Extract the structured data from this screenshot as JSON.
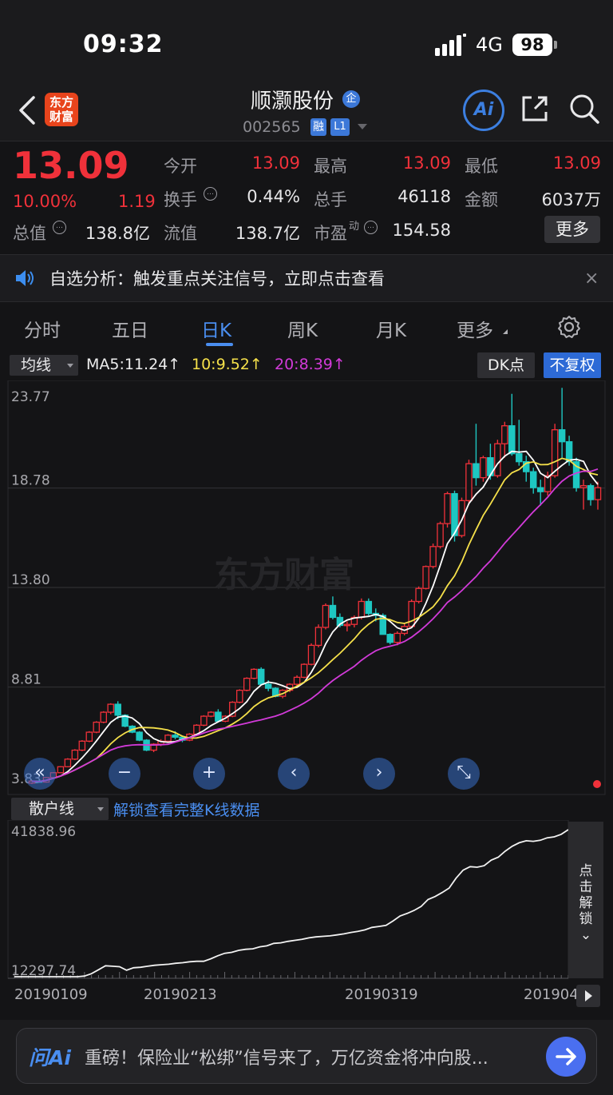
{
  "status_bar": {
    "time": "09:32",
    "network": "4G",
    "battery": "98"
  },
  "header": {
    "app_logo_line1": "东方",
    "app_logo_line2": "财富",
    "stock_name": "顺灏股份",
    "enterprise_badge": "企",
    "stock_code": "002565",
    "margin_badge": "融",
    "level_badge": "L1",
    "ai_label": "Ai"
  },
  "quote": {
    "price": "13.09",
    "change_pct": "10.00%",
    "change_amt": "1.19",
    "open_label": "今开",
    "open": "13.09",
    "high_label": "最高",
    "high": "13.09",
    "low_label": "最低",
    "low": "13.09",
    "turnover_label": "换手",
    "turnover": "0.44%",
    "volume_label": "总手",
    "volume": "46118",
    "amount_label": "金额",
    "amount": "6037万",
    "total_cap_label": "总值",
    "total_cap": "138.8亿",
    "float_cap_label": "流值",
    "float_cap": "138.7亿",
    "pe_label": "市盈",
    "pe_sup": "动",
    "pe": "154.58",
    "more_label": "更多",
    "info_glyph": "…"
  },
  "alert": {
    "text": "自选分析：触发重点关注信号，立即点击查看",
    "close": "×"
  },
  "tabs": [
    {
      "label": "分时"
    },
    {
      "label": "五日"
    },
    {
      "label": "日K"
    },
    {
      "label": "周K"
    },
    {
      "label": "月K"
    },
    {
      "label": "更多"
    }
  ],
  "ma_row": {
    "selector": "均线",
    "ma5": "MA5:11.24↑",
    "ma10": "10:9.52↑",
    "ma20": "20:8.39↑",
    "dk_label": "DK点",
    "fq_label": "不复权"
  },
  "watermark": "东方财富",
  "controls": {
    "fast_back": "«",
    "zoom_out": "−",
    "zoom_in": "+",
    "prev": "‹",
    "next": "›",
    "fullscreen": "⤡"
  },
  "lower": {
    "selector": "散户线",
    "unlock_link": "解锁查看完整K线数据",
    "unlock_side_lines": [
      "点",
      "击",
      "解",
      "锁"
    ],
    "unlock_side_arrow": "⌄"
  },
  "bottom": {
    "ask_ai": "问Ai",
    "prompt": "重磅！保险业“松绑”信号来了，万亿资金将冲向股..."
  },
  "colors": {
    "up": "#f0313a",
    "down": "#1ec7c2",
    "ma5": "#ffffff",
    "ma10": "#f5e04a",
    "ma20": "#d23ad9",
    "accent": "#4a8ef0"
  },
  "chart_data": [
    {
      "type": "candlestick",
      "title": "",
      "y_ticks": [
        "23.77",
        "18.78",
        "13.80",
        "8.81",
        "3.83"
      ],
      "ylim": [
        3.83,
        23.77
      ],
      "grid": true,
      "ohlc": [
        [
          4.0,
          4.12,
          3.95,
          4.1
        ],
        [
          4.1,
          4.15,
          4.02,
          4.05
        ],
        [
          4.05,
          4.3,
          4.02,
          4.28
        ],
        [
          4.28,
          4.55,
          4.25,
          4.52
        ],
        [
          4.52,
          4.85,
          4.5,
          4.82
        ],
        [
          4.82,
          5.25,
          4.8,
          5.2
        ],
        [
          5.2,
          5.7,
          5.15,
          5.65
        ],
        [
          5.65,
          6.15,
          5.6,
          6.1
        ],
        [
          6.1,
          6.6,
          6.05,
          6.55
        ],
        [
          6.55,
          7.1,
          6.5,
          7.05
        ],
        [
          7.05,
          7.6,
          7.0,
          7.55
        ],
        [
          7.55,
          8.0,
          7.45,
          7.95
        ],
        [
          7.95,
          8.1,
          7.2,
          7.4
        ],
        [
          7.4,
          7.45,
          6.8,
          6.85
        ],
        [
          6.85,
          6.9,
          6.5,
          6.55
        ],
        [
          6.55,
          6.6,
          6.1,
          6.15
        ],
        [
          6.15,
          6.2,
          5.6,
          5.65
        ],
        [
          5.65,
          6.0,
          5.55,
          5.95
        ],
        [
          5.95,
          6.2,
          5.85,
          6.1
        ],
        [
          6.1,
          6.45,
          6.0,
          6.4
        ],
        [
          6.4,
          6.6,
          6.2,
          6.3
        ],
        [
          6.3,
          6.35,
          6.05,
          6.15
        ],
        [
          6.15,
          6.5,
          6.1,
          6.45
        ],
        [
          6.45,
          6.95,
          6.4,
          6.9
        ],
        [
          6.9,
          7.4,
          6.85,
          7.35
        ],
        [
          7.35,
          7.6,
          7.3,
          7.55
        ],
        [
          7.55,
          7.7,
          7.05,
          7.1
        ],
        [
          7.1,
          7.4,
          7.05,
          7.35
        ],
        [
          7.35,
          8.1,
          7.3,
          8.05
        ],
        [
          8.05,
          8.7,
          8.0,
          8.65
        ],
        [
          8.65,
          9.3,
          8.6,
          9.25
        ],
        [
          9.25,
          9.75,
          9.2,
          9.7
        ],
        [
          9.7,
          9.8,
          8.9,
          8.95
        ],
        [
          8.95,
          9.15,
          8.6,
          8.75
        ],
        [
          8.75,
          8.8,
          8.3,
          8.35
        ],
        [
          8.35,
          8.7,
          8.25,
          8.65
        ],
        [
          8.65,
          9.0,
          8.55,
          8.95
        ],
        [
          8.95,
          9.4,
          8.85,
          9.3
        ],
        [
          9.3,
          10.0,
          9.25,
          9.95
        ],
        [
          9.95,
          11.0,
          9.9,
          10.9
        ],
        [
          10.9,
          11.95,
          10.8,
          11.8
        ],
        [
          11.8,
          13.0,
          11.7,
          12.9
        ],
        [
          12.9,
          13.35,
          12.2,
          12.3
        ],
        [
          12.3,
          12.5,
          11.8,
          11.9
        ],
        [
          11.9,
          12.1,
          11.6,
          11.95
        ],
        [
          11.95,
          12.4,
          11.8,
          12.3
        ],
        [
          12.3,
          13.25,
          12.2,
          13.1
        ],
        [
          13.1,
          13.25,
          12.4,
          12.5
        ],
        [
          12.5,
          12.75,
          12.1,
          12.4
        ],
        [
          12.4,
          12.5,
          11.8,
          11.45
        ],
        [
          11.45,
          11.5,
          10.95,
          11.05
        ],
        [
          11.05,
          11.6,
          10.9,
          11.5
        ],
        [
          11.5,
          12.0,
          11.4,
          11.85
        ],
        [
          11.85,
          13.2,
          11.8,
          13.1
        ],
        [
          13.1,
          13.85,
          13.0,
          13.75
        ],
        [
          13.75,
          14.9,
          13.7,
          14.85
        ],
        [
          14.85,
          16.0,
          14.75,
          15.85
        ],
        [
          15.85,
          17.1,
          15.75,
          17.0
        ],
        [
          17.0,
          18.6,
          16.8,
          18.5
        ],
        [
          18.5,
          18.65,
          16.1,
          16.4
        ],
        [
          16.4,
          18.3,
          16.3,
          18.15
        ],
        [
          18.15,
          20.2,
          18.0,
          20.0
        ],
        [
          20.0,
          22.0,
          18.9,
          19.3
        ],
        [
          19.3,
          20.4,
          19.1,
          20.3
        ],
        [
          20.3,
          21.0,
          19.2,
          19.4
        ],
        [
          19.4,
          21.2,
          19.3,
          21.0
        ],
        [
          21.0,
          22.1,
          20.3,
          21.9
        ],
        [
          21.9,
          23.5,
          20.4,
          20.5
        ],
        [
          20.5,
          22.2,
          19.9,
          20.1
        ],
        [
          20.1,
          20.4,
          19.1,
          19.6
        ],
        [
          19.6,
          19.8,
          18.5,
          18.8
        ],
        [
          18.8,
          19.2,
          17.9,
          18.6
        ],
        [
          18.6,
          19.6,
          18.4,
          19.4
        ],
        [
          19.4,
          22.0,
          19.3,
          21.7
        ],
        [
          21.7,
          23.8,
          20.3,
          21.1
        ],
        [
          21.1,
          21.4,
          19.9,
          20.1
        ],
        [
          20.1,
          20.3,
          18.6,
          18.8
        ],
        [
          18.8,
          19.2,
          17.7,
          18.9
        ],
        [
          18.9,
          19.0,
          17.9,
          18.2
        ],
        [
          18.2,
          19.1,
          17.7,
          18.8
        ]
      ],
      "ma5_end": 11.24,
      "ma10_end": 9.52,
      "ma20_end": 8.39
    },
    {
      "type": "line",
      "title": "",
      "series": [
        {
          "name": "散户线",
          "values": [
            12297.74,
            12297.74,
            12297.74,
            12297.74,
            12297.74,
            12297.74,
            12297.74,
            12297.74,
            12297.74,
            12297.74,
            12420,
            12900,
            13700,
            14500,
            14400,
            14300,
            13600,
            14100,
            14200,
            14400,
            14600,
            14700,
            14800,
            15000,
            15100,
            15300,
            15400,
            15400,
            15900,
            16500,
            17000,
            17200,
            17600,
            17800,
            17900,
            18300,
            18500,
            19000,
            19100,
            19400,
            19600,
            19800,
            20100,
            20300,
            20400,
            20500,
            20700,
            20900,
            21200,
            21400,
            21700,
            22200,
            22400,
            22600,
            23500,
            24500,
            25000,
            25600,
            26400,
            27800,
            28400,
            29200,
            30100,
            32100,
            33700,
            34400,
            34300,
            34600,
            35700,
            36300,
            37500,
            38500,
            39200,
            39600,
            39500,
            39700,
            40200,
            40400,
            40900,
            41838.96
          ]
        }
      ],
      "y_ticks": [
        "41838.96",
        "12297.74"
      ],
      "ylim": [
        12297.74,
        41838.96
      ],
      "x_ticks": [
        "20190109",
        "20190213",
        "20190319",
        "201904"
      ]
    }
  ]
}
